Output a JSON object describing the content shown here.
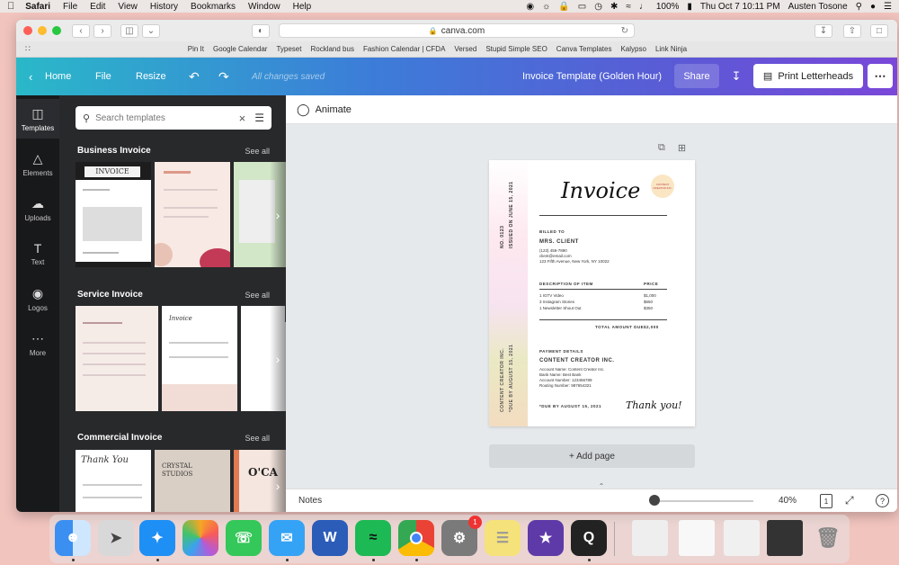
{
  "menubar": {
    "app": "Safari",
    "items": [
      "File",
      "Edit",
      "View",
      "History",
      "Bookmarks",
      "Window",
      "Help"
    ],
    "battery": "100%",
    "clock": "Thu Oct 7  10:11 PM",
    "user": "Austen Tosone"
  },
  "browser": {
    "url": "canva.com",
    "bookmarks": [
      "Pin It",
      "Google Calendar",
      "Typeset",
      "Rockland bus",
      "Fashion Calendar | CFDA",
      "Versed",
      "Stupid Simple SEO",
      "Canva Templates",
      "Kalypso",
      "Link Ninja"
    ]
  },
  "header": {
    "home": "Home",
    "file": "File",
    "resize": "Resize",
    "status": "All changes saved",
    "doc_title": "Invoice Template (Golden Hour)",
    "share": "Share",
    "print": "Print Letterheads"
  },
  "rail": {
    "items": [
      "Templates",
      "Elements",
      "Uploads",
      "Text",
      "Logos",
      "More"
    ]
  },
  "panel": {
    "search_placeholder": "Search templates",
    "sections": [
      {
        "title": "Business Invoice",
        "see_all": "See all"
      },
      {
        "title": "Service Invoice",
        "see_all": "See all"
      },
      {
        "title": "Commercial Invoice",
        "see_all": "See all"
      }
    ],
    "thumb_texts": {
      "invoice_upper": "INVOICE",
      "invoice_script": "Invoice",
      "thank_you": "Thank You",
      "crystal_line1": "CRYSTAL",
      "crystal_line2": "STUDIOS",
      "ocal": "O'CA"
    }
  },
  "editor": {
    "animate": "Animate",
    "add_page": "+ Add page",
    "notes": "Notes",
    "zoom": "40%",
    "page_count": "1",
    "help": "?"
  },
  "invoice": {
    "title": "Invoice",
    "number_line": "NO. 0123",
    "issued_line": "ISSUED ON JUNE 15, 2021",
    "billed_label": "BILLED TO",
    "client": "MRS. CLIENT",
    "client_phone": "(123) 456-7890",
    "client_email": "client@email.com",
    "client_address": "123 Fifth Avenue, New York, NY 10022",
    "desc_header": "DESCRIPTION OF ITEM",
    "price_header": "PRICE",
    "items": [
      {
        "desc": "1 IGTV Video",
        "price": "$1,000"
      },
      {
        "desc": "3 Instagram Stories",
        "price": "$650"
      },
      {
        "desc": "1 Newsletter Shout Out",
        "price": "$350"
      }
    ],
    "total_label": "TOTAL AMOUNT DUE",
    "total": "$2,000",
    "payment_label": "PAYMENT DETAILS",
    "company": "CONTENT CREATOR INC.",
    "account_name": "Account Name: Content Creator Inc.",
    "bank_name": "Bank Name: Best Bank",
    "account_number": "Account Number: 123456789",
    "routing": "Routing Number: 987654321",
    "due": "*DUE BY AUGUST 15, 2021",
    "thanks": "Thank you!",
    "sun_text": "CONTENT CREATOR INC."
  },
  "dock": {
    "badge": "1"
  },
  "colors": {
    "header_start": "#2ab8c9",
    "header_end": "#7a47d9",
    "panel_bg": "#28292b",
    "rail_bg": "#18191b",
    "canvas_bg": "#e6e9ec"
  }
}
